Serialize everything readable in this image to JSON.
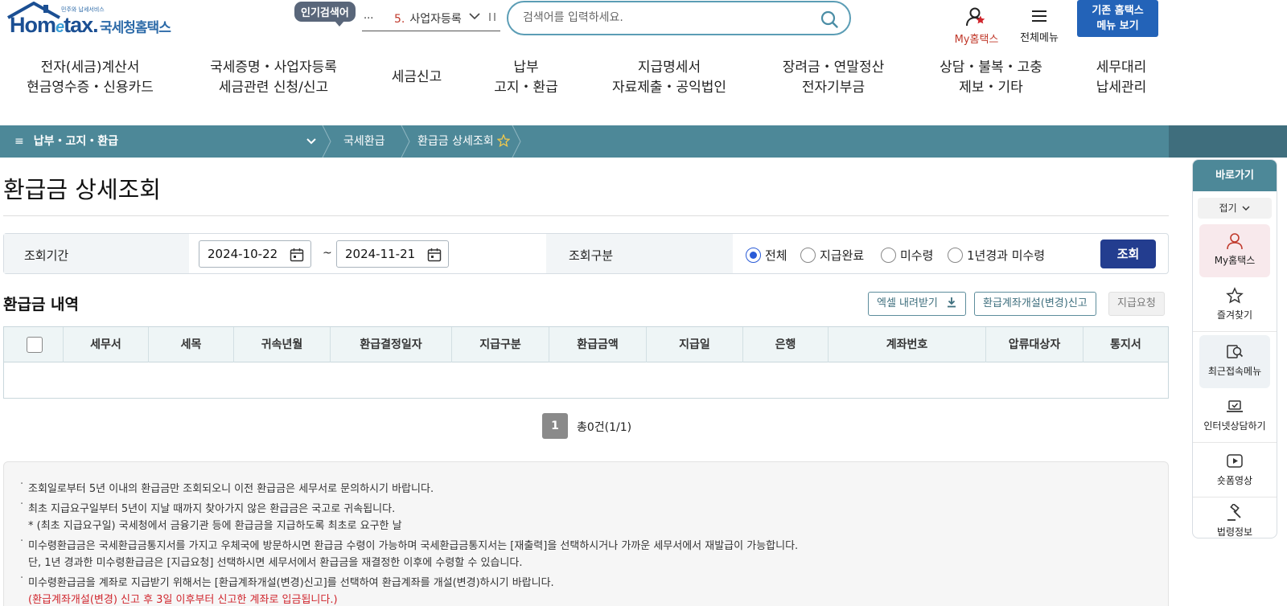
{
  "header": {
    "logo_small": "민주와 납세서비스",
    "logo_text_a": "Hom",
    "logo_text_e": "e",
    "logo_text_b": "tax.",
    "logo_kr": "국세청홈택스",
    "popular_label": "인기검색어",
    "popular_dots": "...",
    "popular_rank": "5.",
    "popular_keyword": "사업자등록",
    "search_placeholder": "검색어를 입력하세요.",
    "my_hometax": "My홈택스",
    "all_menu": "전체메뉴",
    "old_home_line1": "기존 홈택스",
    "old_home_line2": "메뉴 보기",
    "accent_color": "#2363b8"
  },
  "gnb": [
    {
      "line1": "전자(세금)계산서",
      "line2": "현금영수증・신용카드"
    },
    {
      "line1": "국세증명・사업자등록",
      "line2": "세금관련 신청/신고"
    },
    {
      "line1": "세금신고",
      "line2": ""
    },
    {
      "line1": "납부",
      "line2": "고지・환급"
    },
    {
      "line1": "지급명세서",
      "line2": "자료제출・공익법인"
    },
    {
      "line1": "장려금・연말정산",
      "line2": "전자기부금"
    },
    {
      "line1": "상담・불복・고충",
      "line2": "제보・기타"
    },
    {
      "line1": "세무대리",
      "line2": "납세관리"
    }
  ],
  "breadcrumb": {
    "menu": "납부・고지・환급",
    "item1": "국세환급",
    "item2": "환급금 상세조회",
    "bar_color": "#4d8898"
  },
  "page_title": "환급금 상세조회",
  "filter": {
    "period_label": "조회기간",
    "date_from": "2024-10-22",
    "date_to": "2024-11-21",
    "tilde": "~",
    "type_label": "조회구분",
    "options": [
      "전체",
      "지급완료",
      "미수령",
      "1년경과 미수령"
    ],
    "selected": "전체",
    "search_button": "조회"
  },
  "section": {
    "title": "환급금 내역",
    "excel_button": "엑셀 내려받기",
    "account_button": "환급계좌개설(변경)신고",
    "request_button": "지급요청"
  },
  "table": {
    "columns": [
      "세무서",
      "세목",
      "귀속년월",
      "환급결정일자",
      "지급구분",
      "환급금액",
      "지급일",
      "은행",
      "계좌번호",
      "압류대상자",
      "통지서"
    ],
    "rows": []
  },
  "pagination": {
    "current": "1",
    "total": "총0건(1/1)"
  },
  "notice": [
    "조회일로부터 5년 이내의 환급금만 조회되오니 이전 환급금은 세무서로 문의하시기 바랍니다.",
    "최초 지급요구일부터 5년이 지날 때까지 찾아가지 않은 환급금은 국고로 귀속됩니다.",
    "* (최초 지급요구일) 국세청에서 금융기관 등에 환급금을 지급하도록 최초로 요구한 날",
    "미수령환급금은 국세환급금통지서를 가지고 우체국에 방문하시면 환급금 수령이 가능하며 국세환급금통지서는 [재출력]을 선택하시거나 가까운 세무서에서 재발급이 가능합니다.",
    "단, 1년 경과한 미수령환급금은 [지급요청] 선택하시면 세무서에서 환급금을 재결정한 이후에 수령할 수 있습니다.",
    "미수령환급금을 계좌로 지급받기 위해서는 [환급계좌개설(변경)신고]를 선택하여 환급계좌를 개설(변경)하시기 바랍니다.",
    "(환급계좌개설(변경) 신고 후 3일 이후부터 신고한 계좌로 입금됩니다.)"
  ],
  "quick_menu": {
    "title": "바로가기",
    "fold": "접기",
    "items": [
      "My홈택스",
      "즐겨찾기",
      "최근접속메뉴",
      "인터넷상담하기",
      "숏폼영상",
      "법령정보"
    ]
  }
}
